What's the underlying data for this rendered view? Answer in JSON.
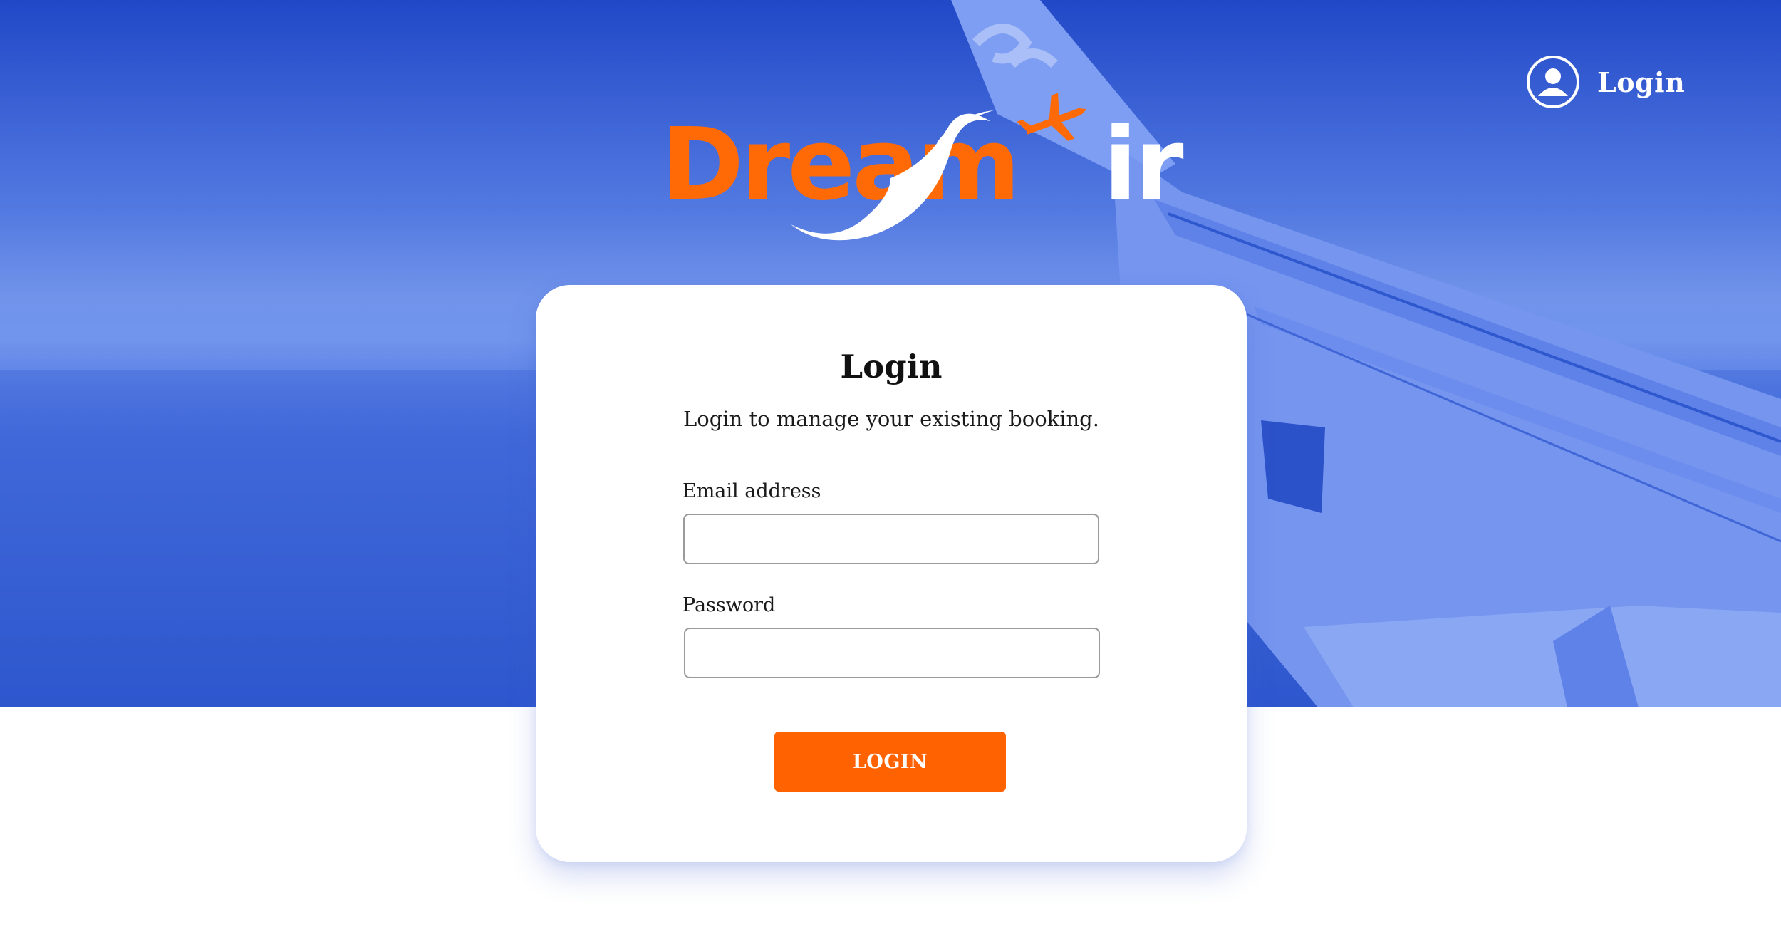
{
  "header": {
    "login_label": "Login",
    "login_icon": "user-circle-icon"
  },
  "brand": {
    "name_part1": "Dream",
    "name_part2": "ir",
    "primary_color": "#ff6a06",
    "secondary_color": "#ffffff",
    "mark_icon": "airplane-swoosh-icon"
  },
  "hero": {
    "background_color": "#3a66dd"
  },
  "login_card": {
    "title": "Login",
    "subtitle": "Login to manage your existing booking.",
    "email": {
      "label": "Email address",
      "value": "",
      "placeholder": ""
    },
    "password": {
      "label": "Password",
      "value": "",
      "placeholder": ""
    },
    "submit_label": "LOGIN",
    "submit_color": "#ff6200"
  }
}
